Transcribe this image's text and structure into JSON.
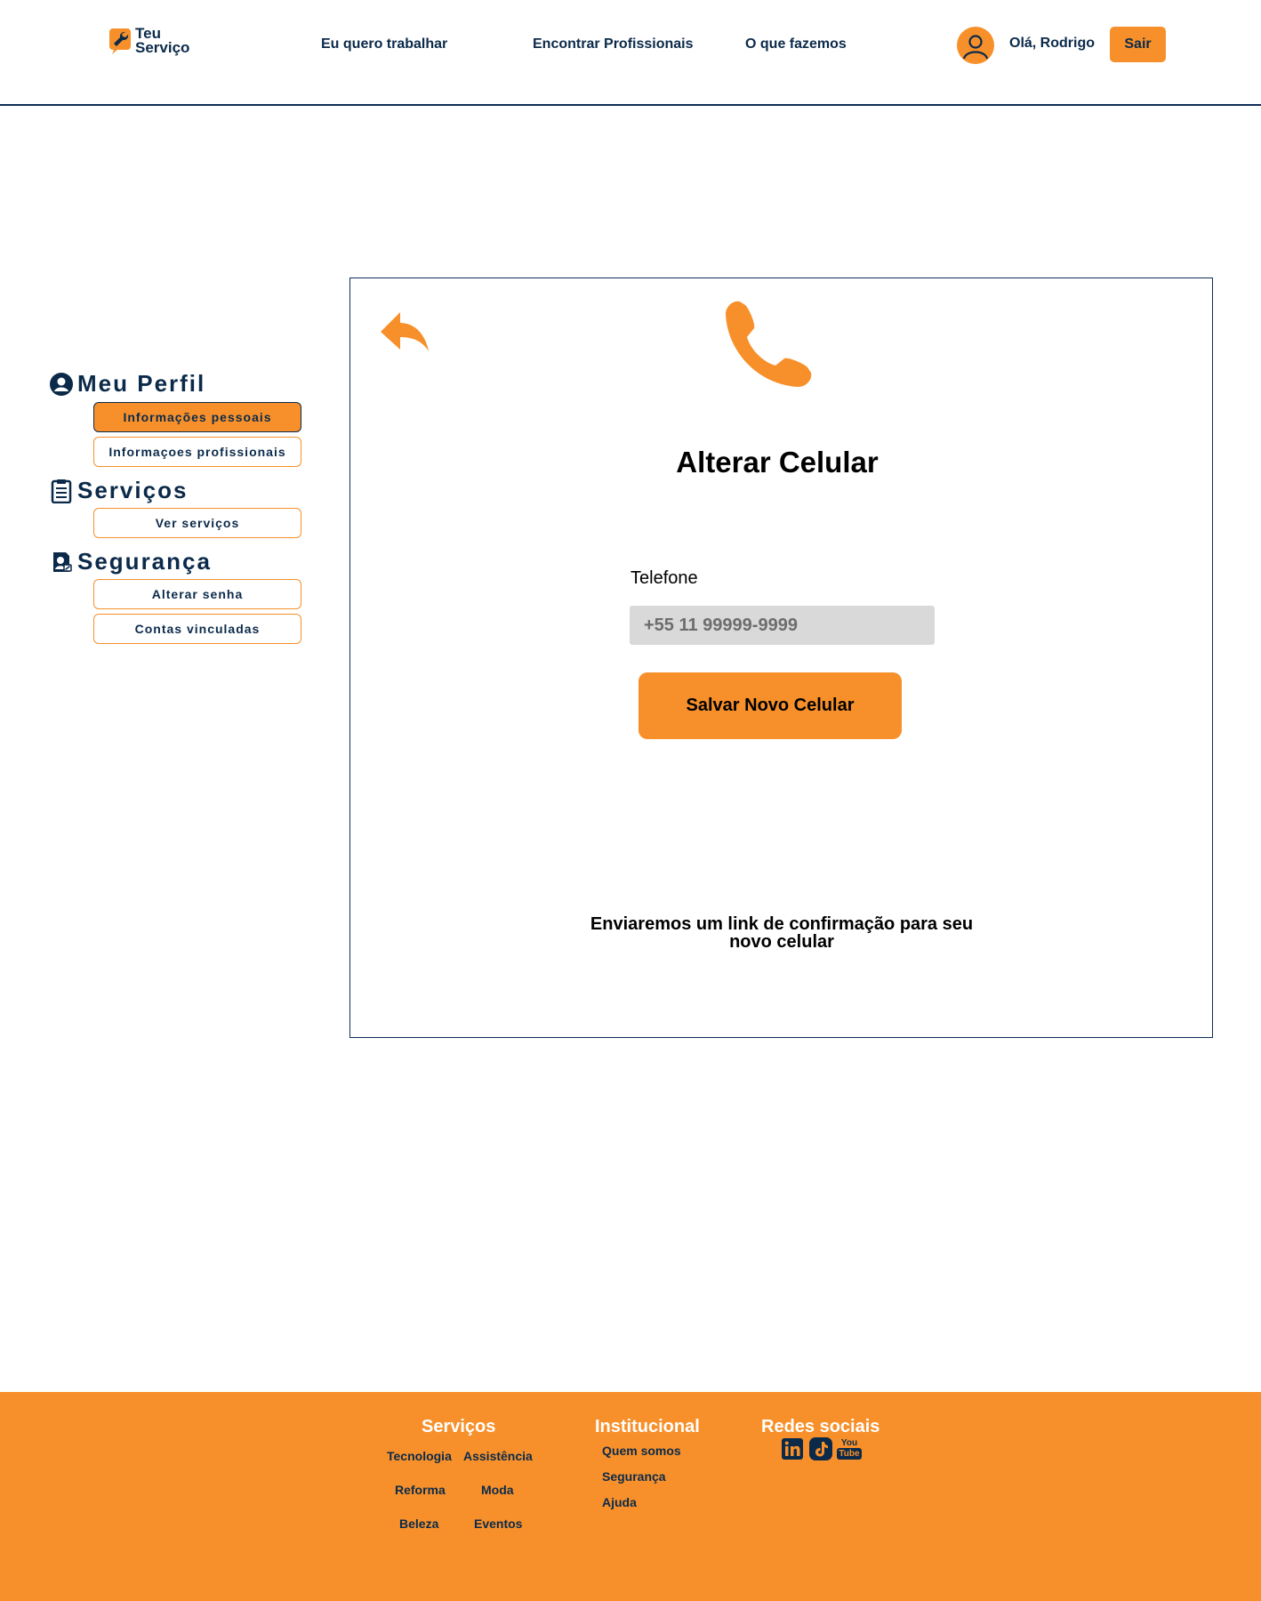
{
  "header": {
    "logo": {
      "line1": "Teu",
      "line2": "Serviço"
    },
    "nav": [
      {
        "label": "Eu quero trabalhar"
      },
      {
        "label": "Encontrar Profissionais"
      },
      {
        "label": "O que fazemos"
      }
    ],
    "greeting": "Olá, Rodrigo",
    "logout_label": "Sair"
  },
  "sidebar": {
    "sections": [
      {
        "title": "Meu Perfil",
        "icon": "user-circle-icon",
        "items": [
          {
            "label": "Informações pessoais",
            "active": true
          },
          {
            "label": "Informaçoes profissionais",
            "active": false
          }
        ]
      },
      {
        "title": "Serviços",
        "icon": "clipboard-icon",
        "items": [
          {
            "label": "Ver serviços",
            "active": false
          }
        ]
      },
      {
        "title": "Segurança",
        "icon": "security-profile-icon",
        "items": [
          {
            "label": "Alterar senha",
            "active": false
          },
          {
            "label": "Contas vinculadas",
            "active": false
          }
        ]
      }
    ]
  },
  "main": {
    "title": "Alterar Celular",
    "field_label": "Telefone",
    "phone_placeholder": "+55 11 99999-9999",
    "save_label": "Salvar Novo Celular",
    "note_line1": "Enviaremos um link de confirmação para seu",
    "note_line2": "novo celular"
  },
  "footer": {
    "services": {
      "heading": "Serviços",
      "links": [
        "Tecnologia",
        "Assistência",
        "Reforma",
        "Moda",
        "Beleza",
        "Eventos"
      ]
    },
    "institutional": {
      "heading": "Institucional",
      "links": [
        "Quem somos",
        "Segurança",
        "Ajuda"
      ]
    },
    "social": {
      "heading": "Redes sociais",
      "icons": [
        "linkedin-icon",
        "tiktok-icon",
        "youtube-icon"
      ],
      "youtube_text1": "You",
      "youtube_text2": "Tube"
    }
  },
  "colors": {
    "accent": "#f7902a",
    "navy": "#0b2a4a",
    "input_bg": "#d9d9d9"
  }
}
